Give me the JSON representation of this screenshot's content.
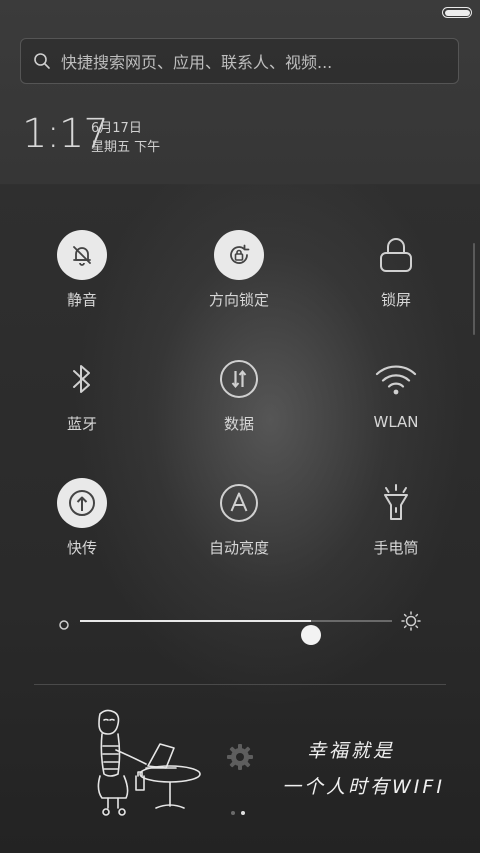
{
  "status_bar": {
    "battery_level": 1.0
  },
  "search": {
    "placeholder": "快捷搜索网页、应用、联系人、视频..."
  },
  "clock": {
    "time": "1:17",
    "date": "6月17日",
    "weekday_period": "星期五 下午"
  },
  "toggles": [
    {
      "label": "静音",
      "icon": "bell-slash-icon",
      "active": true
    },
    {
      "label": "方向锁定",
      "icon": "rotation-lock-icon",
      "active": true
    },
    {
      "label": "锁屏",
      "icon": "lock-icon",
      "active": false
    },
    {
      "label": "蓝牙",
      "icon": "bluetooth-icon",
      "active": false
    },
    {
      "label": "数据",
      "icon": "mobile-data-icon",
      "active": false
    },
    {
      "label": "WLAN",
      "icon": "wifi-icon",
      "active": false
    },
    {
      "label": "快传",
      "icon": "quick-transfer-icon",
      "active": true
    },
    {
      "label": "自动亮度",
      "icon": "auto-brightness-icon",
      "active": false
    },
    {
      "label": "手电筒",
      "icon": "flashlight-icon",
      "active": false
    }
  ],
  "brightness": {
    "level": 0.74
  },
  "banner": {
    "line1": "幸福就是",
    "line2": "一个人时有WIFI",
    "page_count": 2,
    "active_page": 2
  },
  "colors": {
    "active_toggle_bg": "#e9e9e9",
    "text": "#d6d6d6"
  }
}
